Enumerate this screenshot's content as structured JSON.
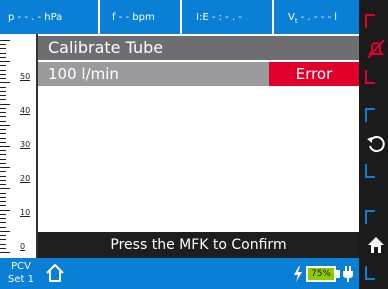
{
  "topbar": {
    "pressure": "p - - . -  hPa",
    "frequency": "f - -  bpm",
    "ie": "I:E - : - . -",
    "volume": "V",
    "volume_sub": "t",
    "volume_value": " - . - - -  l"
  },
  "scale": {
    "labels": [
      "50",
      "40",
      "30",
      "20",
      "10",
      "0"
    ]
  },
  "panel": {
    "title": "Calibrate Tube",
    "value": "100 l/min",
    "error": "Error",
    "confirm": "Press the MFK to Confirm"
  },
  "bottombar": {
    "mode_line1": "PCV",
    "mode_line2": "Set 1",
    "battery": "75%"
  },
  "colors": {
    "accent": "#0a7fd6",
    "error": "#e0002a",
    "battery": "#8ecc00",
    "alarm": "#e0002a",
    "side": "#1b1b1b"
  },
  "side_buttons": [
    "alarm-mute-icon",
    "undo-icon",
    "home-icon"
  ]
}
